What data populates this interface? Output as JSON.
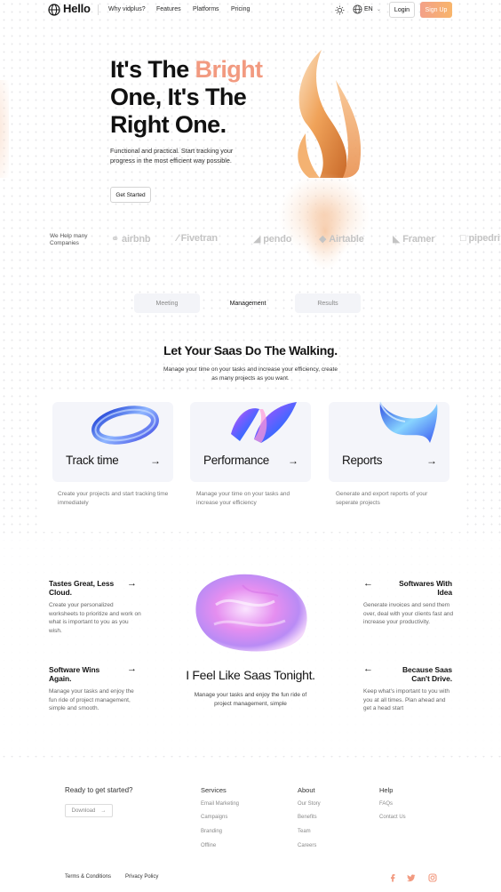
{
  "nav": {
    "logo": "Hello",
    "links": [
      "Why vidplus?",
      "Features",
      "Platforms",
      "Pricing"
    ],
    "language": "EN",
    "login": "Login",
    "signup": "Sign Up"
  },
  "hero": {
    "title_line1_plain": "It's The ",
    "title_line1_accent": "Bright",
    "title_line2": "One, It's The",
    "title_line3": "Right One.",
    "subtitle": "Functional and practical. Start tracking your progress in the most efficient way possible.",
    "cta": "Get Started"
  },
  "companies": {
    "label": "We Help many Companies",
    "brands": [
      "airbnb",
      "Fivetran",
      "pendo",
      "Airtable",
      "Framer",
      "pipedri"
    ]
  },
  "tabs": [
    "Meeting",
    "Management",
    "Results"
  ],
  "section": {
    "title": "Let Your Saas Do The Walking.",
    "subtitle": "Manage your time on your tasks and increase your efficiency, create as many projects as you want."
  },
  "cards": [
    {
      "title": "Track time",
      "desc": "Create your projects and start tracking time immediately"
    },
    {
      "title": "Performance",
      "desc": "Manage your time on your tasks and increase your efficiency"
    },
    {
      "title": "Reports",
      "desc": "Generate and export reports of your seperate projects"
    }
  ],
  "features": {
    "left": [
      {
        "title": "Tastes Great, Less Cloud.",
        "desc": "Create your personalized worksheets to prioritize and work on what is important to you as you wish."
      },
      {
        "title": "Software Wins Again.",
        "desc": "Manage your tasks and enjoy the fun ride of project management, simple and smooth."
      }
    ],
    "right": [
      {
        "title": "Softwares With Idea",
        "desc": "Generate invoices and send them over, deal with your clients fast and increase your productivity."
      },
      {
        "title": "Because Saas Can't Drive.",
        "desc": "Keep what's important to you with you at all times. Plan ahead and get a head start"
      }
    ],
    "center_title": "I Feel Like Saas Tonight.",
    "center_sub": "Manage your tasks and enjoy the fun ride of project management, simple"
  },
  "footer": {
    "ready": "Ready to get started?",
    "download": "Download",
    "columns": [
      {
        "head": "Services",
        "links": [
          "Email Marketing",
          "Campaigns",
          "Branding",
          "Offline"
        ]
      },
      {
        "head": "About",
        "links": [
          "Our Story",
          "Benefits",
          "Team",
          "Careers"
        ]
      },
      {
        "head": "Help",
        "links": [
          "FAQs",
          "Contact Us"
        ]
      }
    ],
    "legal": [
      "Terms & Conditions",
      "Privacy Policy"
    ]
  },
  "icons": {
    "social": [
      "facebook-icon",
      "twitter-icon",
      "instagram-icon"
    ],
    "accent": "#f29a80"
  }
}
